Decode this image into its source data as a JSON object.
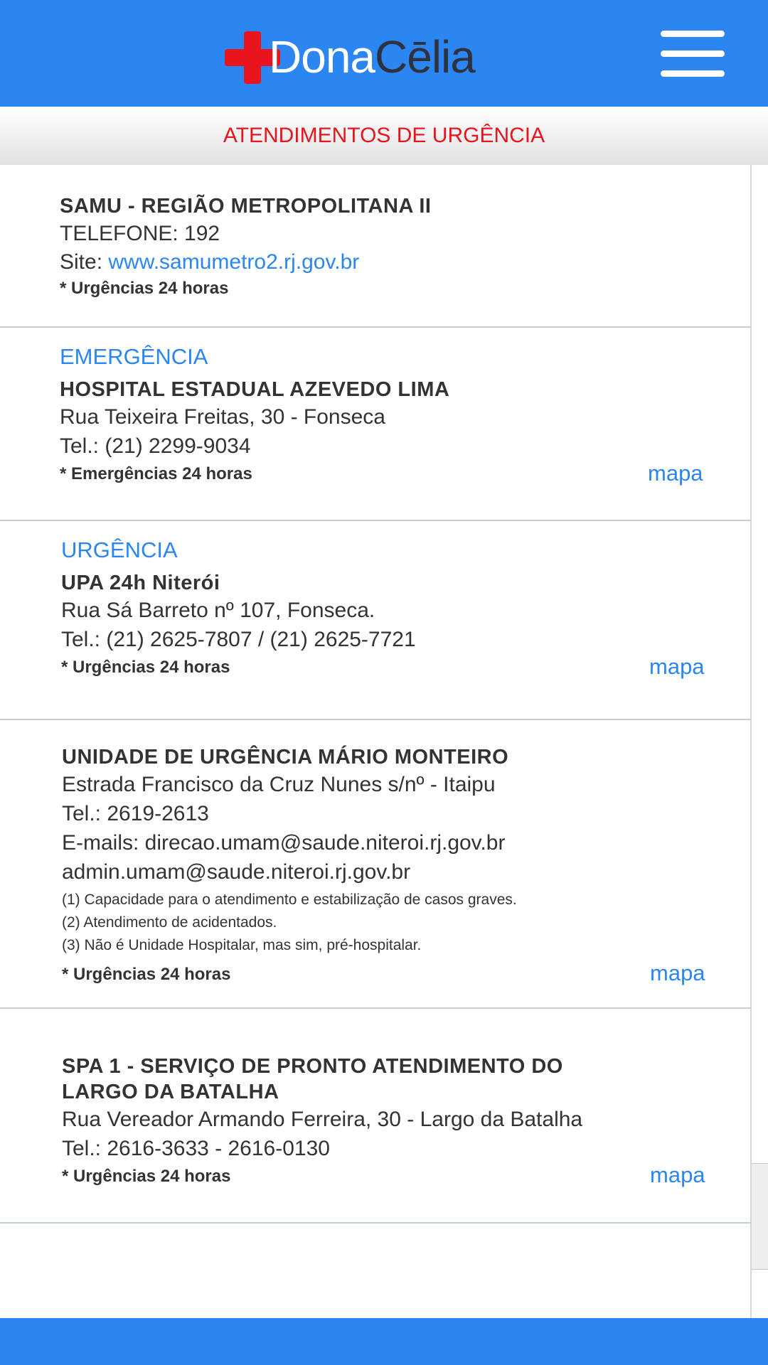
{
  "header": {
    "logo_word1": "Dona",
    "logo_word2": "Cēlia"
  },
  "subheader": {
    "title": "ATENDIMENTOS DE URGÊNCIA"
  },
  "entries": [
    {
      "title": "SAMU - REGIÃO METROPOLITANA II",
      "phone": "TELEFONE: 192",
      "site_label": "Site:",
      "site_url": "www.samumetro2.rj.gov.br",
      "note": "* Urgências 24 horas"
    },
    {
      "category": "EMERGÊNCIA",
      "title": "HOSPITAL ESTADUAL AZEVEDO LIMA",
      "address": "Rua Teixeira Freitas, 30 - Fonseca",
      "phone": "Tel.: (21) 2299-9034",
      "note": "* Emergências 24 horas",
      "map_link": "mapa"
    },
    {
      "category": "URGÊNCIA",
      "title": "UPA 24h Niterói",
      "address": "Rua Sá Barreto nº 107, Fonseca.",
      "phone": "Tel.: (21) 2625-7807 / (21) 2625-7721",
      "note": "* Urgências 24 horas",
      "map_link": "mapa"
    },
    {
      "title": "UNIDADE DE URGÊNCIA MÁRIO MONTEIRO",
      "address": "Estrada Francisco da Cruz Nunes s/nº - Itaipu",
      "phone": "Tel.: 2619-2613",
      "emails_line1": "E-mails: direcao.umam@saude.niteroi.rj.gov.br",
      "emails_line2": "admin.umam@saude.niteroi.rj.gov.br",
      "details": [
        "(1) Capacidade para o atendimento e estabilização de casos graves.",
        "(2) Atendimento de acidentados.",
        "(3) Não é Unidade Hospitalar, mas sim, pré-hospitalar."
      ],
      "note": "* Urgências 24 horas",
      "map_link": "mapa"
    },
    {
      "title_line1": "SPA 1 - SERVIÇO DE PRONTO ATENDIMENTO DO",
      "title_line2": "LARGO DA BATALHA",
      "address": "Rua Vereador Armando Ferreira, 30 - Largo da Batalha",
      "phone": "Tel.: 2616-3633 - 2616-0130",
      "note": "* Urgências 24 horas",
      "map_link": "mapa"
    }
  ],
  "colors": {
    "brand_blue": "#2b86f2",
    "brand_red": "#e8151f",
    "text_dark": "#333333"
  }
}
